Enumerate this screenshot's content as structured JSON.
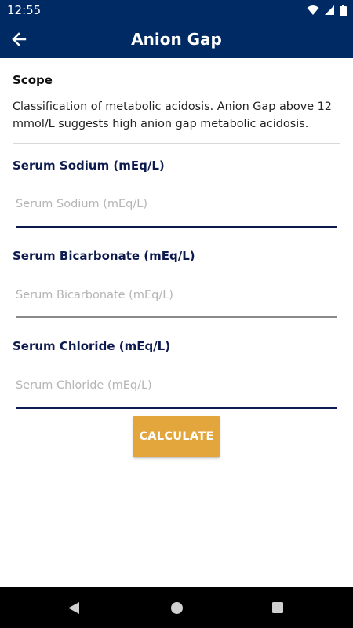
{
  "status_bar": {
    "time": "12:55"
  },
  "header": {
    "title": "Anion Gap",
    "back_icon": "arrow-left-icon"
  },
  "scope": {
    "title": "Scope",
    "text": "Classification of metabolic acidosis. Anion Gap above 12 mmol/L suggests high anion gap metabolic acidosis."
  },
  "fields": [
    {
      "label": "Serum Sodium (mEq/L)",
      "placeholder": "Serum Sodium (mEq/L)",
      "value": ""
    },
    {
      "label": "Serum Bicarbonate (mEq/L)",
      "placeholder": "Serum Bicarbonate (mEq/L)",
      "value": ""
    },
    {
      "label": "Serum Chloride (mEq/L)",
      "placeholder": "Serum Chloride (mEq/L)",
      "value": ""
    }
  ],
  "calculate_button": {
    "label": "CALCULATE"
  },
  "colors": {
    "header_bg": "#002a63",
    "label_color": "#0d1a4d",
    "button_bg": "#e2a63d",
    "active_underline": "#0d1a4d",
    "inactive_underline": "#8a8a8a"
  }
}
